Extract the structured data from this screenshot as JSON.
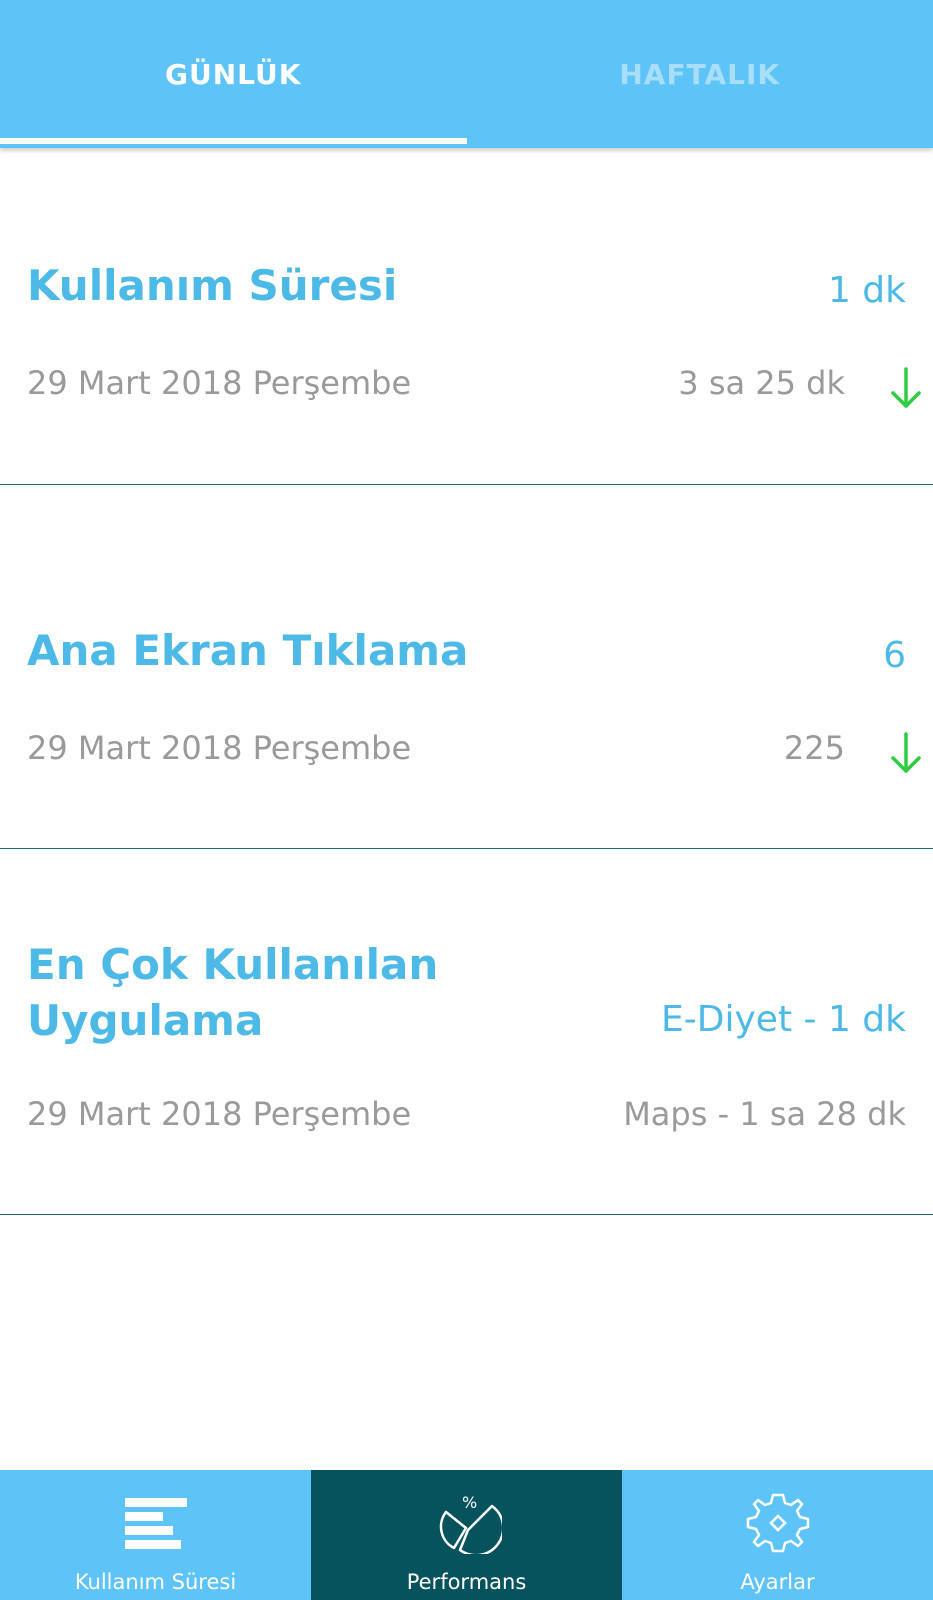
{
  "tabs": [
    {
      "label": "GÜNLÜK",
      "active": true
    },
    {
      "label": "HAFTALIK",
      "active": false
    }
  ],
  "cards": [
    {
      "title": "Kullanım Süresi",
      "value": "1 dk",
      "date": "29 Mart 2018 Perşembe",
      "compare": "3 sa 25 dk",
      "trend_icon": "arrow-down-icon"
    },
    {
      "title": "Ana Ekran Tıklama",
      "value": "6",
      "date": "29 Mart 2018 Perşembe",
      "compare": "225",
      "trend_icon": "arrow-down-icon"
    },
    {
      "title_line1": "En Çok Kullanılan",
      "title_line2": "Uygulama",
      "value": "E-Diyet - 1 dk",
      "date": "29 Mart 2018 Perşembe",
      "compare": "Maps - 1 sa 28 dk"
    }
  ],
  "bottom_nav": [
    {
      "label": "Kullanım Süresi",
      "icon": "bar-list-icon",
      "active": false
    },
    {
      "label": "Performans",
      "icon": "pie-percent-icon",
      "active": true
    },
    {
      "label": "Ayarlar",
      "icon": "gear-icon",
      "active": false
    }
  ],
  "colors": {
    "primary": "#5ec4f7",
    "nav_active": "#07535d",
    "accent_text": "#4db9e6",
    "secondary_text": "#9a9a9a",
    "trend_down": "#2ecc40",
    "divider": "#1f6f7a"
  }
}
